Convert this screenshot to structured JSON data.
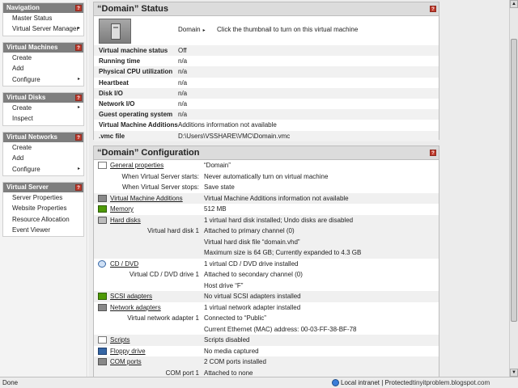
{
  "help_glyph": "?",
  "sidebar": {
    "groups": [
      {
        "title": "Navigation",
        "items": [
          {
            "label": "Master Status",
            "arrow": ""
          },
          {
            "label": "Virtual Server Manager",
            "arrow": "▸"
          }
        ]
      },
      {
        "title": "Virtual Machines",
        "items": [
          {
            "label": "Create",
            "arrow": ""
          },
          {
            "label": "Add",
            "arrow": ""
          },
          {
            "label": "Configure",
            "arrow": "▸"
          }
        ]
      },
      {
        "title": "Virtual Disks",
        "items": [
          {
            "label": "Create",
            "arrow": "▸"
          },
          {
            "label": "Inspect",
            "arrow": ""
          }
        ]
      },
      {
        "title": "Virtual Networks",
        "items": [
          {
            "label": "Create",
            "arrow": ""
          },
          {
            "label": "Add",
            "arrow": ""
          },
          {
            "label": "Configure",
            "arrow": "▸"
          }
        ]
      },
      {
        "title": "Virtual Server",
        "items": [
          {
            "label": "Server Properties",
            "arrow": ""
          },
          {
            "label": "Website Properties",
            "arrow": ""
          },
          {
            "label": "Resource Allocation",
            "arrow": ""
          },
          {
            "label": "Event Viewer",
            "arrow": ""
          }
        ]
      }
    ]
  },
  "status_panel": {
    "title": "“Domain” Status",
    "domain_link": "Domain",
    "domain_arrow": "▸",
    "thumbnail_hint": "Click the thumbnail to turn on this virtual machine",
    "rows": [
      {
        "key": "Virtual machine status",
        "value": "Off"
      },
      {
        "key": "Running time",
        "value": "n/a"
      },
      {
        "key": "Physical CPU utilization",
        "value": "n/a"
      },
      {
        "key": "Heartbeat",
        "value": "n/a"
      },
      {
        "key": "Disk I/O",
        "value": "n/a"
      },
      {
        "key": "Network I/O",
        "value": "n/a"
      },
      {
        "key": "Guest operating system",
        "value": "n/a"
      },
      {
        "key": "Virtual Machine Additions",
        "value": "Additions information not available"
      },
      {
        "key": ".vmc file",
        "value": "D:\\Users\\VSSHARE\\VMC\\Domain.vmc"
      }
    ]
  },
  "config_panel": {
    "title": "“Domain” Configuration",
    "rows": [
      {
        "kind": "head",
        "icon": "general-properties-icon",
        "icon_class": "ic-doc",
        "key": "General properties",
        "value": "“Domain”",
        "shade": false
      },
      {
        "kind": "sub",
        "key": "When Virtual Server starts:",
        "value": "Never automatically turn on virtual machine",
        "shade": false
      },
      {
        "kind": "sub",
        "key": "When Virtual Server stops:",
        "value": "Save state",
        "shade": false
      },
      {
        "kind": "head",
        "icon": "vm-additions-icon",
        "icon_class": "ic-grey",
        "key": "Virtual Machine Additions",
        "value": "Virtual Machine Additions information not available",
        "shade": true
      },
      {
        "kind": "head",
        "icon": "memory-icon",
        "icon_class": "ic-green",
        "key": "Memory",
        "value": "512 MB",
        "shade": false
      },
      {
        "kind": "head",
        "icon": "hard-disk-icon",
        "icon_class": "ic-disk",
        "key": "Hard disks",
        "value": "1 virtual hard disk installed; Undo disks are disabled",
        "shade": true
      },
      {
        "kind": "sub",
        "key": "Virtual hard disk 1",
        "value": "Attached to primary channel (0)",
        "shade": true
      },
      {
        "kind": "sub",
        "key": "",
        "value": "Virtual hard disk file “domain.vhd”",
        "shade": true
      },
      {
        "kind": "sub",
        "key": "",
        "value": "Maximum size is 64 GB; Currently expanded to 4.3 GB",
        "shade": true
      },
      {
        "kind": "head",
        "icon": "cd-dvd-icon",
        "icon_class": "ic-cd",
        "key": "CD / DVD",
        "value": "1 virtual CD / DVD drive installed",
        "shade": false
      },
      {
        "kind": "sub",
        "key": "Virtual CD / DVD drive 1",
        "value": "Attached to secondary channel (0)",
        "shade": false
      },
      {
        "kind": "sub",
        "key": "",
        "value": "Host drive “F”",
        "shade": false
      },
      {
        "kind": "head",
        "icon": "scsi-adapter-icon",
        "icon_class": "ic-green",
        "key": "SCSI adapters",
        "value": "No virtual SCSI adapters installed",
        "shade": true
      },
      {
        "kind": "head",
        "icon": "network-adapter-icon",
        "icon_class": "ic-grey",
        "key": "Network adapters",
        "value": "1 virtual network adapter installed",
        "shade": false
      },
      {
        "kind": "sub",
        "key": "Virtual network adapter 1",
        "value": "Connected to “Public”",
        "shade": false
      },
      {
        "kind": "sub",
        "key": "",
        "value": "Current Ethernet (MAC) address: 00-03-FF-38-BF-78",
        "shade": false
      },
      {
        "kind": "head",
        "icon": "scripts-icon",
        "icon_class": "ic-doc",
        "key": "Scripts",
        "value": "Scripts disabled",
        "shade": true
      },
      {
        "kind": "head",
        "icon": "floppy-drive-icon",
        "icon_class": "ic-blue",
        "key": "Floppy drive",
        "value": "No media captured",
        "shade": false
      },
      {
        "kind": "head",
        "icon": "com-ports-icon",
        "icon_class": "ic-grey",
        "key": "COM ports",
        "value": "2 COM ports installed",
        "shade": true
      },
      {
        "kind": "sub",
        "key": "COM port 1",
        "value": "Attached to none",
        "shade": true
      }
    ]
  },
  "statusbar": {
    "left": "Done",
    "zone": "Local intranet | Protected",
    "watermark": "tinyitproblem.blogspot.com"
  },
  "scrollbar": {
    "up": "▲",
    "down": "▼"
  }
}
